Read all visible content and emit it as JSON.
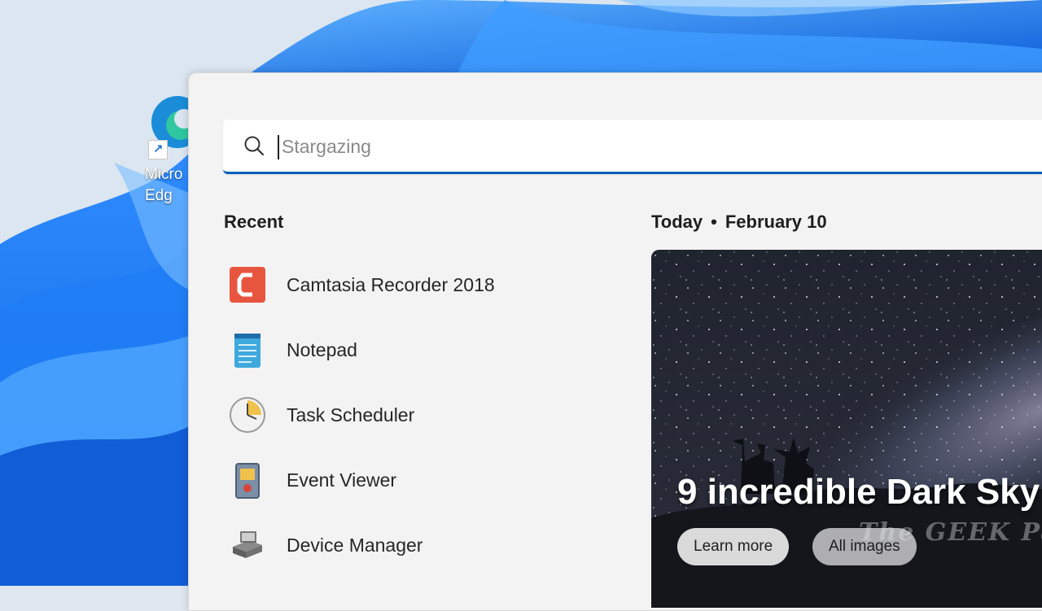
{
  "desktop": {
    "edge_label": "Micro\nEdg"
  },
  "search": {
    "value": "",
    "placeholder": "Stargazing"
  },
  "recent": {
    "heading": "Recent",
    "items": [
      {
        "label": "Camtasia Recorder 2018",
        "icon": "camtasia-icon"
      },
      {
        "label": "Notepad",
        "icon": "notepad-icon"
      },
      {
        "label": "Task Scheduler",
        "icon": "task-scheduler-icon"
      },
      {
        "label": "Event Viewer",
        "icon": "event-viewer-icon"
      },
      {
        "label": "Device Manager",
        "icon": "device-manager-icon"
      }
    ]
  },
  "today": {
    "label": "Today",
    "separator": "•",
    "date": "February 10",
    "card": {
      "title": "9 incredible Dark Sky",
      "learn_more": "Learn more",
      "all_images": "All images",
      "watermark": "The GEEK Page"
    }
  },
  "colors": {
    "accent": "#005fb8",
    "wallpaper_blue": "#1a73e8"
  }
}
